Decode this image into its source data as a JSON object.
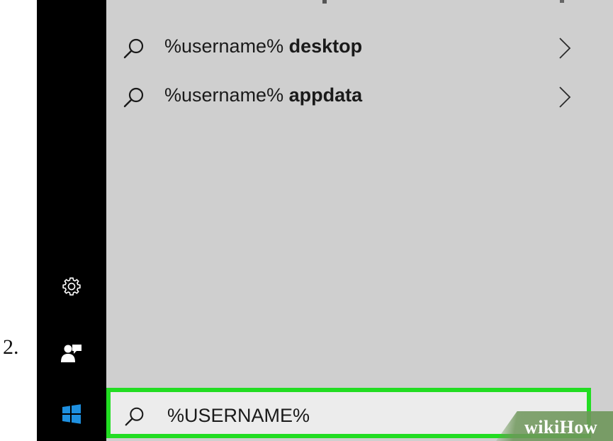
{
  "step": {
    "number": "2."
  },
  "sidebar": {
    "icons": [
      "gear-icon",
      "user-icon",
      "windows-logo-icon"
    ]
  },
  "results": [
    {
      "prefix": "%username% ",
      "bold": "desktop",
      "icon": "search-icon",
      "arrow": "chevron-right-icon"
    },
    {
      "prefix": "%username% ",
      "bold": "appdata",
      "icon": "search-icon",
      "arrow": "chevron-right-icon"
    }
  ],
  "search": {
    "value": "%USERNAME%",
    "icon": "search-icon",
    "highlight_color": "#22dd22"
  },
  "watermark": {
    "text": "wikiHow"
  },
  "colors": {
    "sidebar_bg": "#000000",
    "panel_bg": "#cfcfcf",
    "searchbox_bg": "#ececec",
    "windows_blue": "#1e90e0"
  }
}
